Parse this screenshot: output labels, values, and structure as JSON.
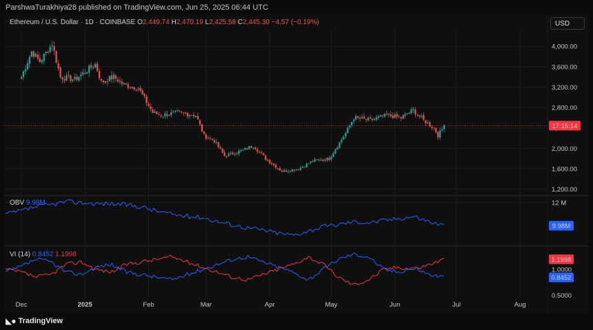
{
  "header": {
    "published": "ParshwaTurakhiya28 published on TradingView.com, Jun 25, 2025 06:44 UTC"
  },
  "legend": {
    "symbol": "Ethereum / U.S. Dollar · 1D · COINBASE",
    "o_label": "O",
    "o_value": "2,449.74",
    "h_label": "H",
    "h_value": "2,470.19",
    "l_label": "L",
    "l_value": "2,425.58",
    "c_label": "C",
    "c_value": "2,445.30",
    "change": "−4.57 (−0.19%)"
  },
  "currency": "USD",
  "obv": {
    "label": "OBV",
    "value": "9.98M",
    "badge": "9.98M"
  },
  "vi": {
    "label": "VI (14)",
    "plus": "0.8452",
    "minus": "1.1998",
    "badge_plus": "0.8452",
    "badge_minus": "1.1998"
  },
  "countdown": "17:15:14",
  "footer": {
    "brand": "TradingView"
  },
  "colors": {
    "up": "#26a69a",
    "down": "#ef5350",
    "obv": "#2962ff",
    "vi_plus": "#2962ff",
    "vi_minus": "#f23645",
    "grid": "#1e1e1e",
    "countdown": "#f23645"
  },
  "chart_data": [
    {
      "type": "candlestick",
      "title": "Ethereum / U.S. Dollar · 1D · COINBASE",
      "x_ticks": [
        "Dec",
        "2025",
        "Feb",
        "Mar",
        "Apr",
        "May",
        "Jun",
        "Jul",
        "Aug"
      ],
      "y_ticks": [
        "4,000.00",
        "3,600.00",
        "3,200.00",
        "2,800.00",
        "2,400.00",
        "2,000.00",
        "1,600.00",
        "1,200.00"
      ],
      "ylim": [
        1100,
        4300
      ],
      "current_price": 2445.3,
      "series": [
        {
          "name": "ETHUSD",
          "keypoints": [
            [
              "2024-12-01",
              3400
            ],
            [
              "2024-12-06",
              3900
            ],
            [
              "2024-12-10",
              3700
            ],
            [
              "2024-12-16",
              4050
            ],
            [
              "2024-12-20",
              3400
            ],
            [
              "2024-12-27",
              3350
            ],
            [
              "2025-01-06",
              3650
            ],
            [
              "2025-01-09",
              3300
            ],
            [
              "2025-01-15",
              3400
            ],
            [
              "2025-01-20",
              3250
            ],
            [
              "2025-01-27",
              3180
            ],
            [
              "2025-02-03",
              2700
            ],
            [
              "2025-02-07",
              2650
            ],
            [
              "2025-02-15",
              2700
            ],
            [
              "2025-02-24",
              2650
            ],
            [
              "2025-02-28",
              2250
            ],
            [
              "2025-03-05",
              2150
            ],
            [
              "2025-03-10",
              1850
            ],
            [
              "2025-03-18",
              1950
            ],
            [
              "2025-03-24",
              2050
            ],
            [
              "2025-03-30",
              1800
            ],
            [
              "2025-04-07",
              1550
            ],
            [
              "2025-04-15",
              1600
            ],
            [
              "2025-04-22",
              1750
            ],
            [
              "2025-04-30",
              1800
            ],
            [
              "2025-05-08",
              2300
            ],
            [
              "2025-05-12",
              2600
            ],
            [
              "2025-05-20",
              2550
            ],
            [
              "2025-05-28",
              2650
            ],
            [
              "2025-06-04",
              2600
            ],
            [
              "2025-06-10",
              2750
            ],
            [
              "2025-06-15",
              2550
            ],
            [
              "2025-06-20",
              2400
            ],
            [
              "2025-06-22",
              2250
            ],
            [
              "2025-06-25",
              2445
            ]
          ]
        }
      ]
    },
    {
      "type": "line",
      "title": "OBV",
      "y_ticks": [
        "12 M"
      ],
      "series": [
        {
          "name": "OBV",
          "values": [
            10.9,
            11.2,
            11.6,
            11.8,
            12.1,
            12.0,
            11.9,
            11.9,
            11.8,
            11.6,
            11.2,
            10.9,
            10.7,
            10.6,
            10.2,
            9.9,
            9.6,
            9.4,
            9.1,
            8.9,
            9.3,
            9.7,
            9.9,
            10.2,
            10.1,
            10.3,
            10.5,
            10.7,
            10.2,
            9.8
          ]
        }
      ]
    },
    {
      "type": "line",
      "title": "VI (14)",
      "y_ticks": [
        "1.0000",
        "0.5000"
      ],
      "series": [
        {
          "name": "VI+",
          "values": [
            0.95,
            1.05,
            1.2,
            1.15,
            0.95,
            0.9,
            1.05,
            1.1,
            0.95,
            0.9,
            0.85,
            0.8,
            0.9,
            1.0,
            1.1,
            1.2,
            1.25,
            1.15,
            1.05,
            0.95,
            0.8,
            1.0,
            1.2,
            1.3,
            1.25,
            1.0,
            0.95,
            1.05,
            0.9,
            0.85
          ]
        },
        {
          "name": "VI-",
          "values": [
            1.0,
            0.95,
            0.85,
            0.9,
            1.1,
            1.15,
            1.0,
            0.95,
            1.1,
            1.15,
            1.2,
            1.25,
            1.15,
            1.05,
            0.95,
            0.85,
            0.8,
            0.9,
            1.0,
            1.1,
            1.25,
            1.1,
            0.85,
            0.7,
            0.8,
            1.0,
            1.05,
            1.0,
            1.1,
            1.2
          ]
        }
      ]
    }
  ]
}
